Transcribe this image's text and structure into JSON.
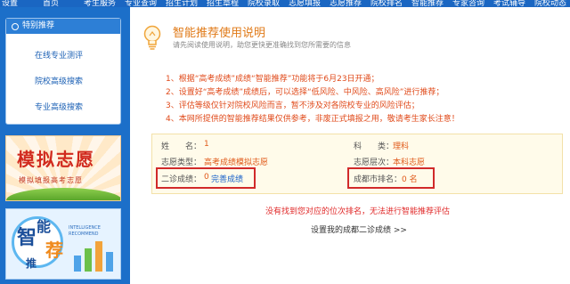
{
  "top_nav": [
    "设置",
    "首页",
    "考生服务",
    "专业查询",
    "招生计划",
    "招生章程",
    "院校录取",
    "志愿填报",
    "志愿推荐",
    "院校排名",
    "智能推荐",
    "专家咨询",
    "考试辅导",
    "院校动态"
  ],
  "sidebar": {
    "header": "特别推荐",
    "items": [
      {
        "label": "在线专业测评"
      },
      {
        "label": "院校高级搜索"
      },
      {
        "label": "专业高级搜索"
      }
    ],
    "banner_simulate": {
      "title": "模拟志愿",
      "subtitle": "模拟填报高考志愿"
    },
    "banner_smart": {
      "title_a": "智",
      "title_b": "能",
      "title_c": "荐",
      "title_d": "推",
      "english": "INTELLIGENCE RECOMMEND"
    }
  },
  "main": {
    "title": "智能推荐使用说明",
    "subtitle": "请先阅读使用说明，助您更快更准确找到您所需要的信息",
    "rules": [
      "1、根据“高考成绩”成绩“智能推荐”功能将于6月23日开通；",
      "2、设置好“高考成绩”成绩后，可以选择“低风险、中风险、高风险”进行推荐；",
      "3、评估等级仅针对院校风险而言，暂不涉及对各院校专业的风险评估；",
      "4、本网所提供的智能推荐结果仅供参考，非废正式填报之用，敬请考生家长注意！"
    ],
    "info": {
      "name_label": "姓　　名：",
      "name_value": "1",
      "subject_label": "科　　类：",
      "subject_value": "理科",
      "type_label": "志愿类型：",
      "type_value": "高考成绩模拟志愿",
      "level_label": "志愿层次：",
      "level_value": "本科志愿",
      "score_label": "二诊成绩：",
      "score_value": "0",
      "score_link": "完善成绩",
      "rank_label": "成都市排名：",
      "rank_value": "0 名"
    },
    "warning": "没有找到您对应的位次排名，无法进行智能推荐评估",
    "set_link": "设置我的成都二诊成绩 >>"
  },
  "colors": {
    "brand_blue": "#1c6fc9",
    "accent_orange": "#e07a18",
    "alert_red": "#e02828"
  }
}
